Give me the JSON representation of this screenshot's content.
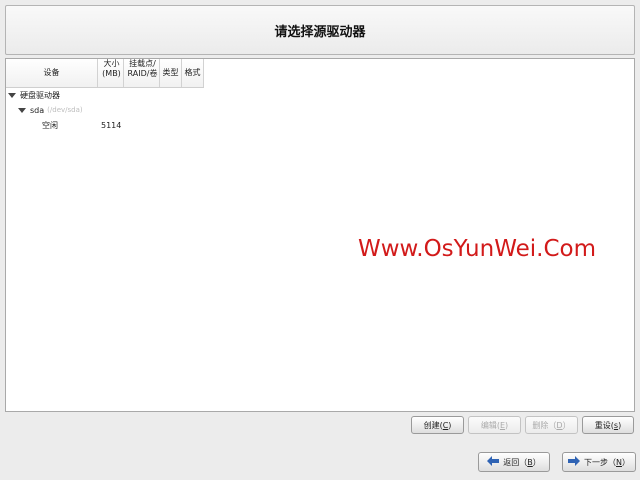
{
  "header": {
    "title": "请选择源驱动器"
  },
  "columns": {
    "device": "设备",
    "size_line1": "大小",
    "size_line2": "(MB)",
    "mount_line1": "挂载点/",
    "mount_line2": "RAID/卷",
    "type": "类型",
    "format": "格式"
  },
  "tree": {
    "group_label": "硬盘驱动器",
    "disk_name": "sda",
    "disk_path": "(/dev/sda)",
    "free_label": "空闲",
    "free_size": "5114"
  },
  "watermark": "Www.OsYunWei.Com",
  "actions": {
    "create_label": "创建(",
    "create_key": "C",
    "edit_label": "编辑(",
    "edit_key": "E",
    "delete_label": "删除（",
    "delete_key": "D",
    "delete_suffix": "）",
    "reset_label": "重设(",
    "reset_key": "s",
    "close_paren": ")"
  },
  "nav": {
    "back_label": "返回（",
    "back_key": "B",
    "next_label": "下一步（",
    "next_key": "N",
    "close_paren": "）",
    "back_icon": "arrow-left-icon",
    "next_icon": "arrow-right-icon",
    "icon_color": "#2f63b4"
  }
}
